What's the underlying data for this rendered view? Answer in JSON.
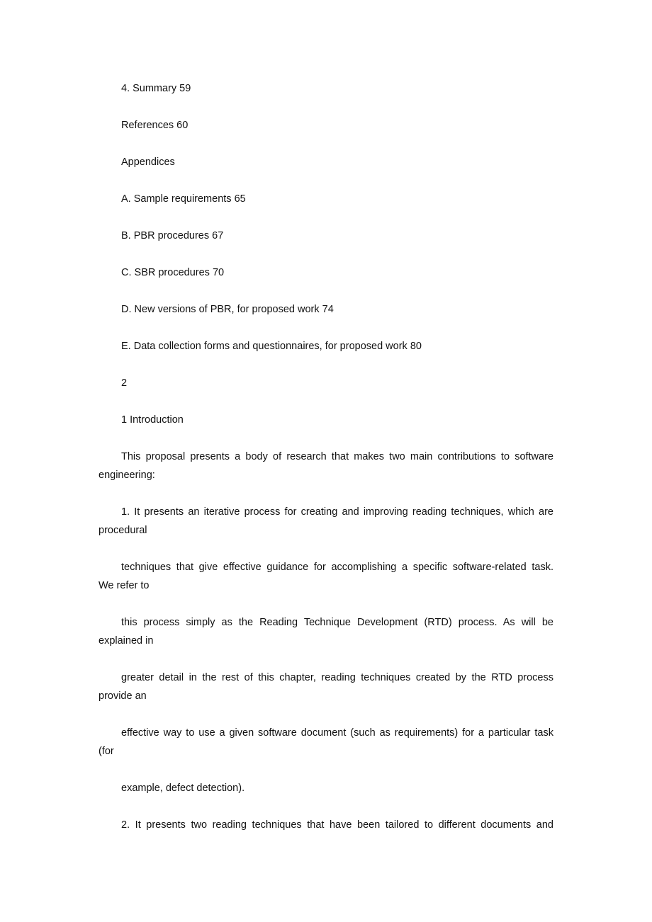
{
  "toc": {
    "summary": "4. Summary 59",
    "references": "References 60",
    "appendices_heading": "Appendices",
    "appendix_a": "A. Sample requirements 65",
    "appendix_b": "B. PBR procedures 67",
    "appendix_c": "C. SBR procedures 70",
    "appendix_d": "D. New versions of PBR, for proposed work 74",
    "appendix_e": "E. Data collection forms and questionnaires, for proposed work 80"
  },
  "page_number": "2",
  "section_heading": "1 Introduction",
  "paragraphs": [
    {
      "first": "This proposal presents a body of research that makes two main contributions to software",
      "rest": "engineering:"
    },
    {
      "first": "1. It presents an iterative process for creating and improving reading techniques, which are",
      "rest": "procedural"
    },
    {
      "first": "techniques that give effective guidance for accomplishing a specific software-related task.",
      "rest": "We refer to"
    },
    {
      "first": "this process simply as the Reading Technique Development (RTD) process. As will be",
      "rest": "explained in"
    },
    {
      "first": "greater detail in the rest of this chapter, reading techniques created by the RTD process",
      "rest": "provide an"
    },
    {
      "first": "effective way to use a given software document (such as requirements) for a particular task",
      "rest": "(for"
    },
    {
      "first": "example, defect detection).",
      "rest": ""
    },
    {
      "first": "2. It presents two reading techniques that have been tailored to different documents and",
      "rest": ""
    }
  ]
}
